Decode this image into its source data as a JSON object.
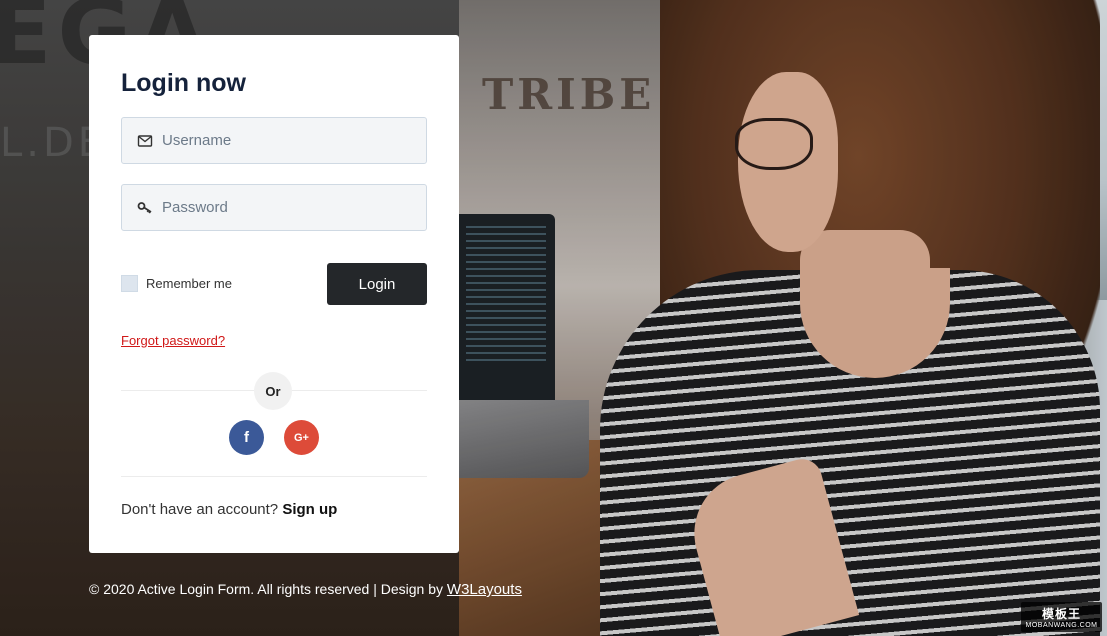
{
  "login": {
    "title": "Login now",
    "username_placeholder": "Username",
    "password_placeholder": "Password",
    "remember_label": "Remember me",
    "login_label": "Login",
    "forgot_label": "Forgot password?",
    "or_label": "Or",
    "social": [
      {
        "name": "facebook",
        "icon": "facebook-icon",
        "glyph": "f",
        "color": "#3b5998"
      },
      {
        "name": "google-plus",
        "icon": "google-plus-icon",
        "glyph": "G+",
        "color": "#dd4b39"
      }
    ],
    "signup_prompt": "Don't have an account?",
    "signup_label": "Sign up"
  },
  "footer": {
    "text": "© 2020 Active Login Form. All rights reserved | Design by",
    "link_label": "W3Layouts"
  },
  "watermark": {
    "top": "模板王",
    "bottom": "MOBANWANG.COM"
  },
  "colors": {
    "title": "#15223b",
    "button": "#24272a",
    "link_red": "#d01818",
    "facebook": "#3b5998",
    "google": "#dd4b39"
  }
}
